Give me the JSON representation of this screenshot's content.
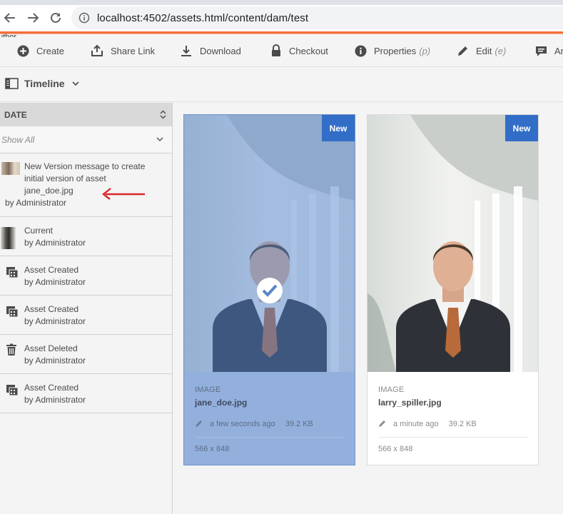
{
  "browser": {
    "url": "localhost:4502/assets.html/content/dam/test"
  },
  "header": {
    "author_label": "uthor"
  },
  "toolbar": {
    "create": "Create",
    "share_link": "Share Link",
    "download": "Download",
    "checkout": "Checkout",
    "properties": "Properties",
    "properties_hint": "(p)",
    "edit": "Edit",
    "edit_hint": "(e)",
    "annotate_partial": "Ar"
  },
  "rail": {
    "selector_label": "Timeline",
    "date_header": "DATE",
    "filter_value": "Show All",
    "entries": [
      {
        "title": "New Version message to create initial version of asset jane_doe.jpg",
        "title_lines": [
          "New Version message to create",
          "initial version of asset",
          "jane_doe.jpg"
        ],
        "by": "by Administrator",
        "icon": "thumbnail-icon"
      },
      {
        "title": "Current",
        "by": "by Administrator",
        "icon": "thumbnail-icon"
      },
      {
        "title": "Asset Created",
        "by": "by Administrator",
        "icon": "film-icon"
      },
      {
        "title": "Asset Created",
        "by": "by Administrator",
        "icon": "film-icon"
      },
      {
        "title": "Asset Deleted",
        "by": "by Administrator",
        "icon": "trash-icon"
      },
      {
        "title": "Asset Created",
        "by": "by Administrator",
        "icon": "film-icon"
      }
    ]
  },
  "cards": [
    {
      "badge": "New",
      "type": "IMAGE",
      "name": "jane_doe.jpg",
      "modified": "a few seconds ago",
      "size": "39.2 KB",
      "dimensions": "566 x 848",
      "selected": true
    },
    {
      "badge": "New",
      "type": "IMAGE",
      "name": "larry_spiller.jpg",
      "modified": "a minute ago",
      "size": "39.2 KB",
      "dimensions": "566 x 848",
      "selected": false
    }
  ],
  "colors": {
    "accent": "#f26f3c",
    "badge": "#326ec8",
    "annotation_arrow": "#d9262d"
  }
}
